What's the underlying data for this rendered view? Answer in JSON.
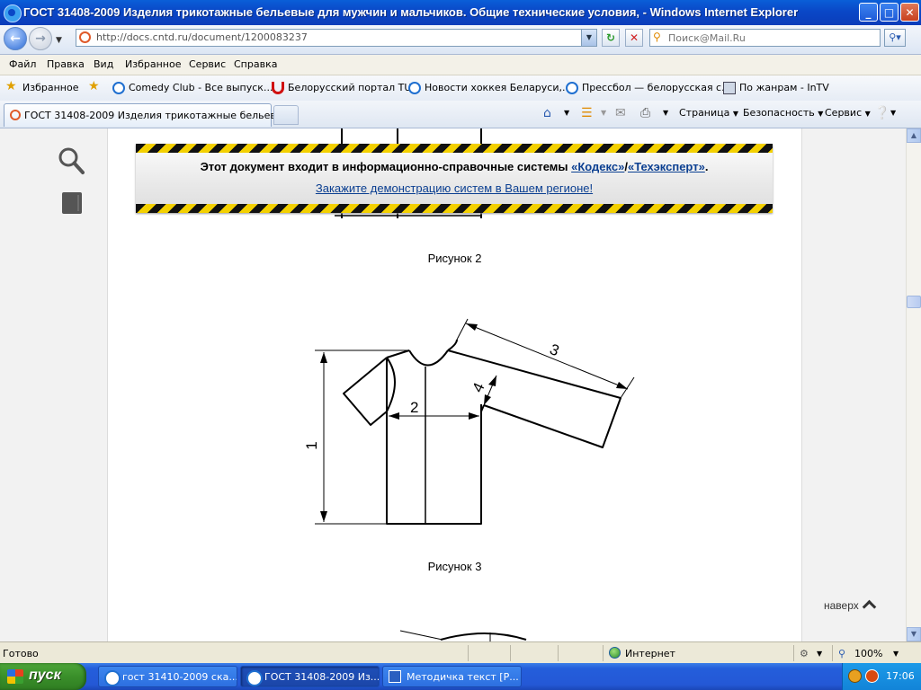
{
  "window": {
    "title": "ГОСТ 31408-2009 Изделия трикотажные бельевые для мужчин и мальчиков. Общие технические условия, - Windows Internet Explorer",
    "minimize": "_",
    "maximize": "□",
    "close": "✕"
  },
  "address": {
    "url": "http://docs.cntd.ru/document/1200083237",
    "search_placeholder": "Поиск@Mail.Ru"
  },
  "menu": [
    "Файл",
    "Правка",
    "Вид",
    "Избранное",
    "Сервис",
    "Справка"
  ],
  "favorites": {
    "label": "Избранное",
    "items": [
      "Comedy Club - Все выпуск...",
      "Белорусский портал TUT",
      "Новости хоккея Беларуси,...",
      "Прессбол — белорусская с...",
      "По жанрам - InTV"
    ]
  },
  "tab": {
    "label": "ГОСТ 31408-2009 Изделия трикотажные бельевы..."
  },
  "commands": {
    "page": "Страница",
    "safety": "Безопасность",
    "tools": "Сервис"
  },
  "banner": {
    "line1_prefix": "Этот документ входит в информационно-справочные системы",
    "link_kodeks": "«Кодекс»",
    "separator": "/",
    "link_tech": "«Техэксперт»",
    "line1_suffix": ".",
    "line2_link": "Закажите демонстрацию систем в Вашем регионе!"
  },
  "figures": {
    "caption2": "Рисунок 2",
    "caption3": "Рисунок 3",
    "dim_labels": [
      "1",
      "2",
      "3",
      "4"
    ]
  },
  "to_top": "наверх",
  "status": {
    "text": "Готово",
    "zone": "Интернет",
    "zoom": "100%"
  },
  "taskbar": {
    "start": "пуск",
    "items": [
      "гост 31410-2009 ска...",
      "ГОСТ 31408-2009 Из...",
      "Методичка текст [Р..."
    ],
    "clock": "17:06"
  }
}
